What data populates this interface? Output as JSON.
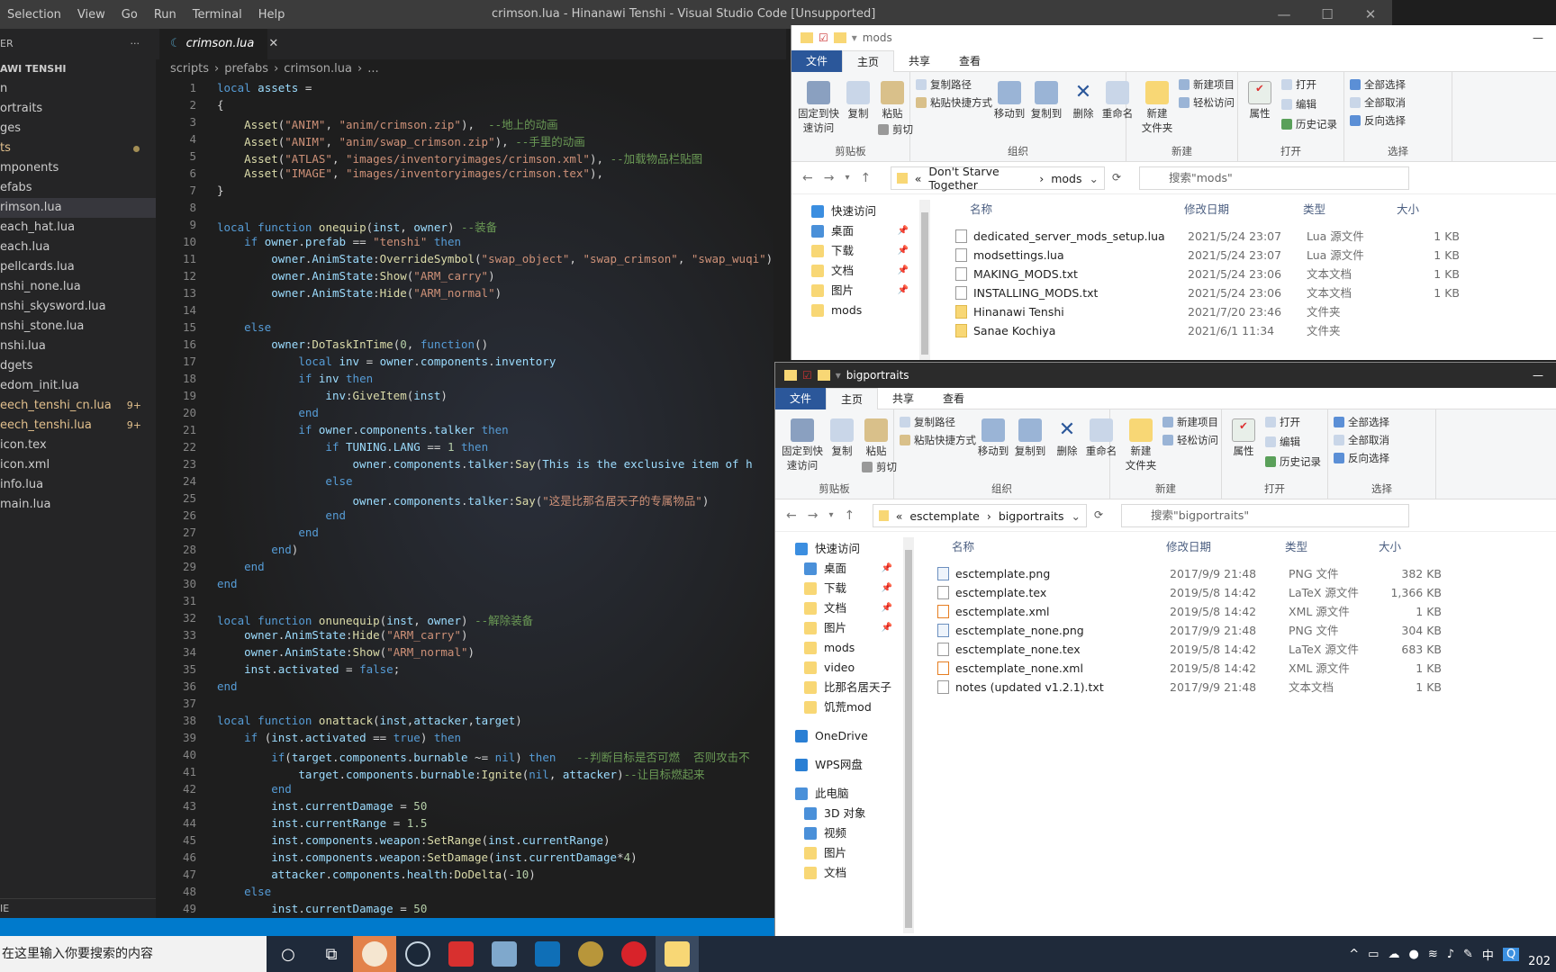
{
  "vscode": {
    "menu": [
      "Selection",
      "View",
      "Go",
      "Run",
      "Terminal",
      "Help"
    ],
    "title": "crimson.lua - Hinanawi Tenshi - Visual Studio Code [Unsupported]",
    "explorer_label": "ER",
    "project_name": "AWI TENSHI",
    "tab_label": "crimson.lua",
    "breadcrumb": [
      "scripts",
      "prefabs",
      "crimson.lua",
      "..."
    ],
    "sidebar_items": [
      {
        "label": "n",
        "state": ""
      },
      {
        "label": "ortraits",
        "state": ""
      },
      {
        "label": "ges",
        "state": ""
      },
      {
        "label": "ts",
        "state": "mod-dot"
      },
      {
        "label": "mponents",
        "state": ""
      },
      {
        "label": "efabs",
        "state": ""
      },
      {
        "label": "rimson.lua",
        "state": "sel"
      },
      {
        "label": "each_hat.lua",
        "state": ""
      },
      {
        "label": "each.lua",
        "state": ""
      },
      {
        "label": "pellcards.lua",
        "state": ""
      },
      {
        "label": "nshi_none.lua",
        "state": ""
      },
      {
        "label": "nshi_skysword.lua",
        "state": ""
      },
      {
        "label": "nshi_stone.lua",
        "state": ""
      },
      {
        "label": "nshi.lua",
        "state": ""
      },
      {
        "label": "dgets",
        "state": ""
      },
      {
        "label": "edom_init.lua",
        "state": ""
      },
      {
        "label": "eech_tenshi_cn.lua",
        "state": "mod",
        "badge": "9+"
      },
      {
        "label": "eech_tenshi.lua",
        "state": "mod",
        "badge": "9+"
      },
      {
        "label": "icon.tex",
        "state": ""
      },
      {
        "label": "icon.xml",
        "state": ""
      },
      {
        "label": "info.lua",
        "state": ""
      },
      {
        "label": "main.lua",
        "state": ""
      }
    ],
    "sidebar_footer": "IE",
    "code_lines": [
      [
        "1",
        "local assets ="
      ],
      [
        "2",
        "{"
      ],
      [
        "3",
        "    Asset(\"ANIM\", \"anim/crimson.zip\"),  --地上的动画"
      ],
      [
        "4",
        "    Asset(\"ANIM\", \"anim/swap_crimson.zip\"), --手里的动画"
      ],
      [
        "5",
        "    Asset(\"ATLAS\", \"images/inventoryimages/crimson.xml\"), --加载物品栏贴图"
      ],
      [
        "6",
        "    Asset(\"IMAGE\", \"images/inventoryimages/crimson.tex\"),"
      ],
      [
        "7",
        "}"
      ],
      [
        "8",
        ""
      ],
      [
        "9",
        "local function onequip(inst, owner) --装备"
      ],
      [
        "10",
        "    if owner.prefab == \"tenshi\" then"
      ],
      [
        "11",
        "        owner.AnimState:OverrideSymbol(\"swap_object\", \"swap_crimson\", \"swap_wuqi\")"
      ],
      [
        "12",
        "        owner.AnimState:Show(\"ARM_carry\")"
      ],
      [
        "13",
        "        owner.AnimState:Hide(\"ARM_normal\")"
      ],
      [
        "14",
        ""
      ],
      [
        "15",
        "    else"
      ],
      [
        "16",
        "        owner:DoTaskInTime(0, function()"
      ],
      [
        "17",
        "            local inv = owner.components.inventory"
      ],
      [
        "18",
        "            if inv then"
      ],
      [
        "19",
        "                inv:GiveItem(inst)"
      ],
      [
        "20",
        "            end"
      ],
      [
        "21",
        "            if owner.components.talker then"
      ],
      [
        "22",
        "                if TUNING.LANG == 1 then"
      ],
      [
        "23",
        "                    owner.components.talker:Say(\"This is the exclusive item of h"
      ],
      [
        "24",
        "                else"
      ],
      [
        "25",
        "                    owner.components.talker:Say(\"这是比那名居天子的专属物品\")"
      ],
      [
        "26",
        "                end"
      ],
      [
        "27",
        "            end"
      ],
      [
        "28",
        "        end)"
      ],
      [
        "29",
        "    end"
      ],
      [
        "30",
        "end"
      ],
      [
        "31",
        ""
      ],
      [
        "32",
        "local function onunequip(inst, owner) --解除装备"
      ],
      [
        "33",
        "    owner.AnimState:Hide(\"ARM_carry\")"
      ],
      [
        "34",
        "    owner.AnimState:Show(\"ARM_normal\")"
      ],
      [
        "35",
        "    inst.activated = false;"
      ],
      [
        "36",
        "end"
      ],
      [
        "37",
        ""
      ],
      [
        "38",
        "local function onattack(inst,attacker,target)"
      ],
      [
        "39",
        "    if (inst.activated == true) then"
      ],
      [
        "40",
        "        if(target.components.burnable ~= nil) then   --判断目标是否可燃  否则攻击不"
      ],
      [
        "41",
        "            target.components.burnable:Ignite(nil, attacker)--让目标燃起来"
      ],
      [
        "42",
        "        end"
      ],
      [
        "43",
        "        inst.currentDamage = 50"
      ],
      [
        "44",
        "        inst.currentRange = 1.5"
      ],
      [
        "45",
        "        inst.components.weapon:SetRange(inst.currentRange)"
      ],
      [
        "46",
        "        inst.components.weapon:SetDamage(inst.currentDamage*4)"
      ],
      [
        "47",
        "        attacker.components.health:DoDelta(-10)"
      ],
      [
        "48",
        "    else"
      ],
      [
        "49",
        "        inst.currentDamage = 50"
      ]
    ]
  },
  "explorer_common": {
    "tabs": [
      "文件",
      "主页",
      "共享",
      "查看"
    ],
    "ribbon": {
      "pin": "固定到快\n速访问",
      "copy": "复制",
      "paste": "粘贴",
      "copy_path": "复制路径",
      "paste_shortcut": "粘贴快捷方式",
      "cut": "剪切",
      "move_to": "移动到",
      "copy_to": "复制到",
      "delete": "删除",
      "rename": "重命名",
      "new_folder": "新建\n文件夹",
      "new_item": "新建项目",
      "easy_access": "轻松访问",
      "properties": "属性",
      "open": "打开",
      "edit": "编辑",
      "history": "历史记录",
      "select_all": "全部选择",
      "select_none": "全部取消",
      "invert": "反向选择",
      "g_clipboard": "剪贴板",
      "g_organize": "组织",
      "g_new": "新建",
      "g_open": "打开",
      "g_select": "选择"
    },
    "columns": [
      "名称",
      "修改日期",
      "类型",
      "大小"
    ]
  },
  "explorer_mods": {
    "title": "mods",
    "path": [
      "Don't Starve Together",
      "mods"
    ],
    "search_placeholder": "搜索\"mods\"",
    "tree": [
      {
        "label": "快速访问",
        "pin": false
      },
      {
        "label": "桌面",
        "pin": true
      },
      {
        "label": "下载",
        "pin": true
      },
      {
        "label": "文档",
        "pin": true
      },
      {
        "label": "图片",
        "pin": true
      },
      {
        "label": "mods",
        "pin": false
      }
    ],
    "files": [
      {
        "name": "dedicated_server_mods_setup.lua",
        "date": "2021/5/24 23:07",
        "type": "Lua 源文件",
        "size": "1 KB",
        "kind": "file"
      },
      {
        "name": "modsettings.lua",
        "date": "2021/5/24 23:07",
        "type": "Lua 源文件",
        "size": "1 KB",
        "kind": "file"
      },
      {
        "name": "MAKING_MODS.txt",
        "date": "2021/5/24 23:06",
        "type": "文本文档",
        "size": "1 KB",
        "kind": "file"
      },
      {
        "name": "INSTALLING_MODS.txt",
        "date": "2021/5/24 23:06",
        "type": "文本文档",
        "size": "1 KB",
        "kind": "file"
      },
      {
        "name": "Hinanawi Tenshi",
        "date": "2021/7/20 23:46",
        "type": "文件夹",
        "size": "",
        "kind": "folder"
      },
      {
        "name": "Sanae Kochiya",
        "date": "2021/6/1 11:34",
        "type": "文件夹",
        "size": "",
        "kind": "folder"
      }
    ]
  },
  "explorer_big": {
    "title": "bigportraits",
    "path": [
      "esctemplate",
      "bigportraits"
    ],
    "search_placeholder": "搜索\"bigportraits\"",
    "tree": [
      {
        "label": "快速访问",
        "pin": false,
        "indent": 0
      },
      {
        "label": "桌面",
        "pin": true,
        "indent": 1
      },
      {
        "label": "下载",
        "pin": true,
        "indent": 1
      },
      {
        "label": "文档",
        "pin": true,
        "indent": 1
      },
      {
        "label": "图片",
        "pin": true,
        "indent": 1
      },
      {
        "label": "mods",
        "pin": false,
        "indent": 1
      },
      {
        "label": "video",
        "pin": false,
        "indent": 1
      },
      {
        "label": "比那名居天子",
        "pin": false,
        "indent": 1
      },
      {
        "label": "饥荒mod",
        "pin": false,
        "indent": 1
      },
      {
        "label": "",
        "pin": false,
        "indent": 0
      },
      {
        "label": "OneDrive",
        "pin": false,
        "indent": 0
      },
      {
        "label": "",
        "pin": false,
        "indent": 0
      },
      {
        "label": "WPS网盘",
        "pin": false,
        "indent": 0
      },
      {
        "label": "",
        "pin": false,
        "indent": 0
      },
      {
        "label": "此电脑",
        "pin": false,
        "indent": 0
      },
      {
        "label": "3D 对象",
        "pin": false,
        "indent": 1
      },
      {
        "label": "视频",
        "pin": false,
        "indent": 1
      },
      {
        "label": "图片",
        "pin": false,
        "indent": 1
      },
      {
        "label": "文档",
        "pin": false,
        "indent": 1
      }
    ],
    "files": [
      {
        "name": "esctemplate.png",
        "date": "2017/9/9 21:48",
        "type": "PNG 文件",
        "size": "382 KB",
        "kind": "png"
      },
      {
        "name": "esctemplate.tex",
        "date": "2019/5/8 14:42",
        "type": "LaTeX 源文件",
        "size": "1,366 KB",
        "kind": "file"
      },
      {
        "name": "esctemplate.xml",
        "date": "2019/5/8 14:42",
        "type": "XML 源文件",
        "size": "1 KB",
        "kind": "xml"
      },
      {
        "name": "esctemplate_none.png",
        "date": "2017/9/9 21:48",
        "type": "PNG 文件",
        "size": "304 KB",
        "kind": "png"
      },
      {
        "name": "esctemplate_none.tex",
        "date": "2019/5/8 14:42",
        "type": "LaTeX 源文件",
        "size": "683 KB",
        "kind": "file"
      },
      {
        "name": "esctemplate_none.xml",
        "date": "2019/5/8 14:42",
        "type": "XML 源文件",
        "size": "1 KB",
        "kind": "xml"
      },
      {
        "name": "notes (updated v1.2.1).txt",
        "date": "2017/9/9 21:48",
        "type": "文本文档",
        "size": "1 KB",
        "kind": "file"
      }
    ]
  },
  "taskbar": {
    "search_placeholder": "在这里输入你要搜索的内容",
    "tray_lang": "中",
    "clock_fragment": "202"
  },
  "colors": {
    "keyword": "#569cd6",
    "string": "#ce9178",
    "comment": "#6a9955",
    "function": "#dcdcaa",
    "variable": "#9cdcfe",
    "accent_blue": "#007acc",
    "explorer_file_tab": "#2b579a"
  }
}
